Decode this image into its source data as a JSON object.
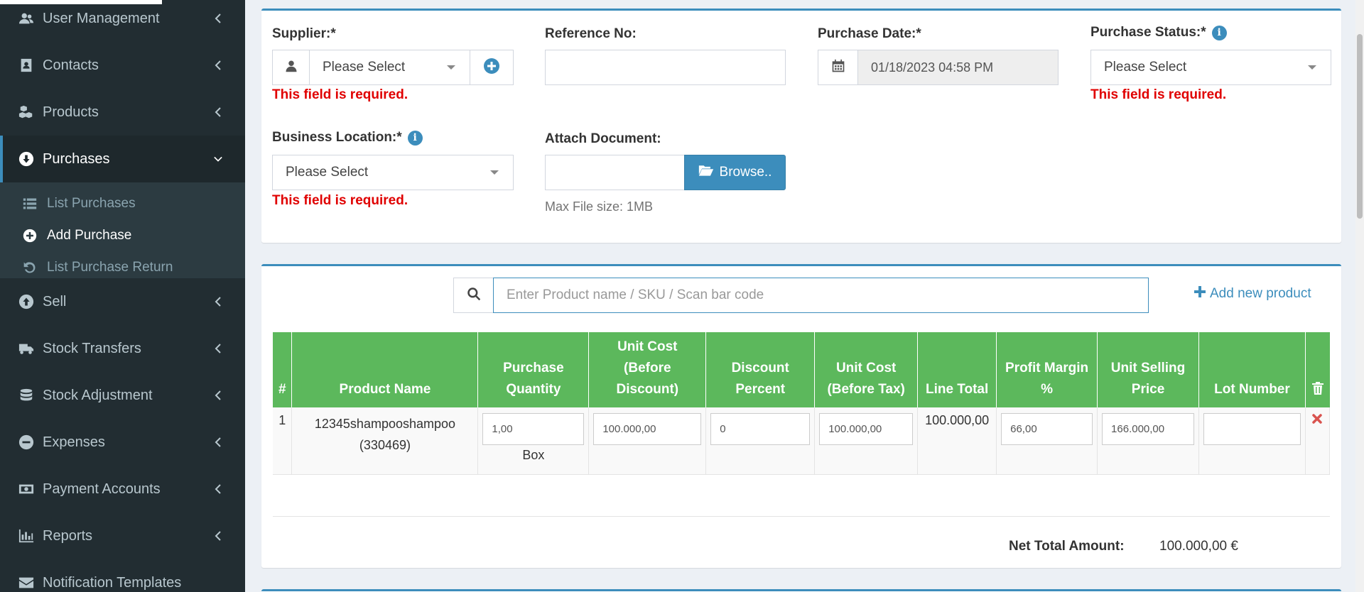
{
  "sidebar": {
    "items": [
      {
        "label": "User Management",
        "icon": "users-icon"
      },
      {
        "label": "Contacts",
        "icon": "address-book-icon"
      },
      {
        "label": "Products",
        "icon": "cubes-icon"
      },
      {
        "label": "Purchases",
        "icon": "arrow-circle-down-icon"
      },
      {
        "label": "Sell",
        "icon": "arrow-circle-up-icon"
      },
      {
        "label": "Stock Transfers",
        "icon": "truck-icon"
      },
      {
        "label": "Stock Adjustment",
        "icon": "database-icon"
      },
      {
        "label": "Expenses",
        "icon": "minus-circle-icon"
      },
      {
        "label": "Payment Accounts",
        "icon": "money-icon"
      },
      {
        "label": "Reports",
        "icon": "bar-chart-icon"
      },
      {
        "label": "Notification Templates",
        "icon": "envelope-icon"
      }
    ],
    "submenu": [
      {
        "label": "List Purchases",
        "icon": "list-icon"
      },
      {
        "label": "Add Purchase",
        "icon": "plus-circle-icon"
      },
      {
        "label": "List Purchase Return",
        "icon": "undo-icon"
      }
    ]
  },
  "form": {
    "supplier_label": "Supplier:*",
    "supplier_value": "Please Select",
    "reference_label": "Reference No:",
    "reference_value": "",
    "purchase_date_label": "Purchase Date:*",
    "purchase_date_value": "01/18/2023 04:58 PM",
    "purchase_status_label": "Purchase Status:*",
    "purchase_status_value": "Please Select",
    "business_location_label": "Business Location:*",
    "business_location_value": "Please Select",
    "attach_label": "Attach Document:",
    "browse_label": "Browse..",
    "max_file_hint": "Max File size: 1MB",
    "required_error": "This field is required."
  },
  "products": {
    "search_placeholder": "Enter Product name / SKU / Scan bar code",
    "add_new_label": "Add new product",
    "columns": [
      "#",
      "Product Name",
      "Purchase Quantity",
      "Unit Cost (Before Discount)",
      "Discount Percent",
      "Unit Cost (Before Tax)",
      "Line Total",
      "Profit Margin %",
      "Unit Selling Price",
      "Lot Number"
    ],
    "rows": [
      {
        "index": "1",
        "name": "12345shampooshampoo (330469)",
        "quantity": "1,00",
        "unit": "Box",
        "unit_cost_before_discount": "100.000,00",
        "discount_percent": "0",
        "unit_cost_before_tax": "100.000,00",
        "line_total": "100.000,00",
        "profit_margin": "66,00",
        "unit_selling_price": "166.000,00",
        "lot_number": ""
      }
    ],
    "net_total_label": "Net Total Amount:",
    "net_total_value": "100.000,00 €"
  },
  "colors": {
    "sidebar_bg": "#222d32",
    "accent": "#3c8dbc",
    "table_header": "#5cb85c",
    "error": "#e00000"
  }
}
